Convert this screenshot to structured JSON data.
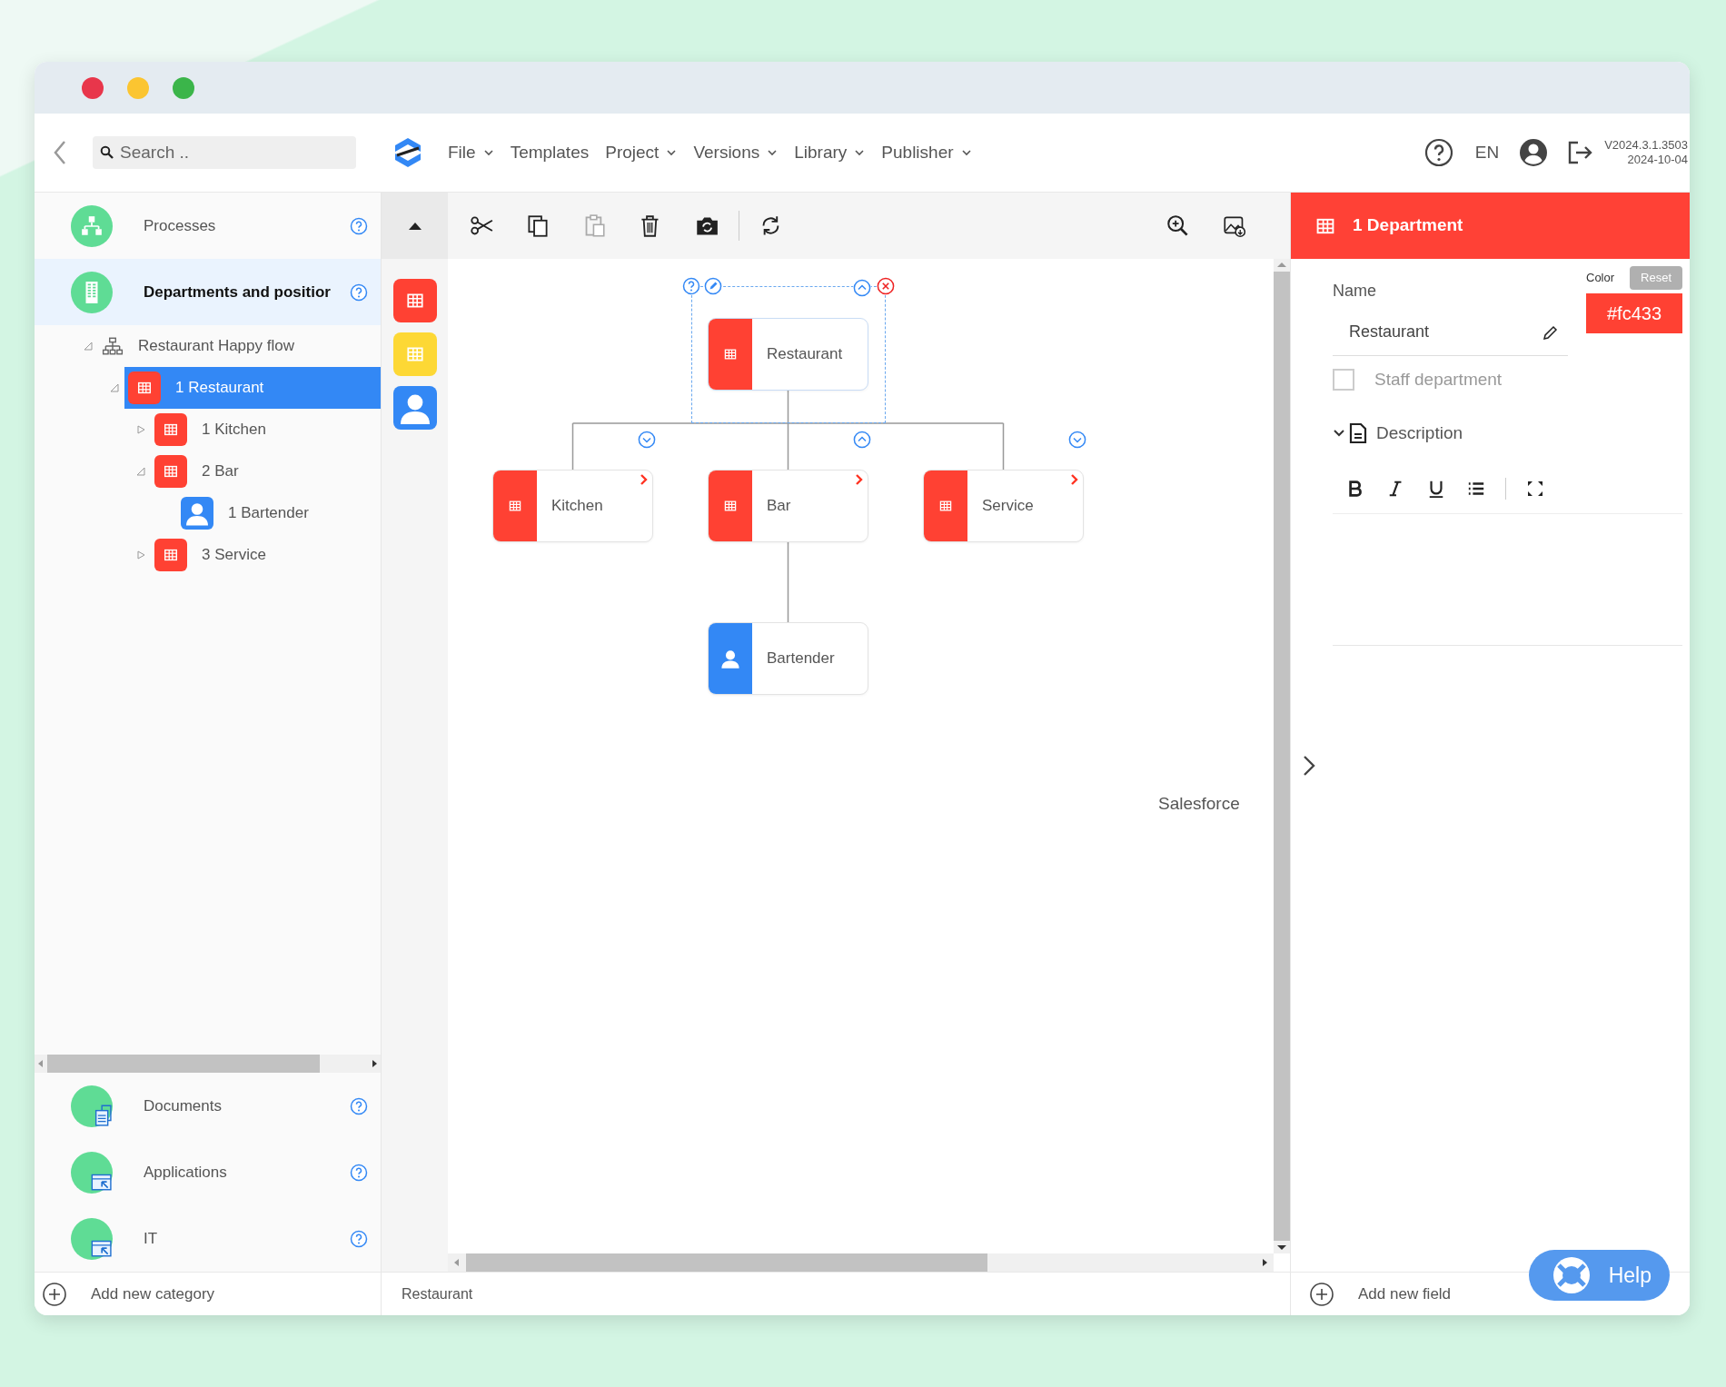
{
  "window": {
    "buttons": [
      {
        "color": "#e8364b"
      },
      {
        "color": "#fbc531"
      },
      {
        "color": "#3bb54a"
      }
    ]
  },
  "topbar": {
    "search": {
      "placeholder": "Search .."
    },
    "menu": [
      {
        "label": "File",
        "dropdown": true
      },
      {
        "label": "Templates",
        "dropdown": false
      },
      {
        "label": "Project",
        "dropdown": true
      },
      {
        "label": "Versions",
        "dropdown": true
      },
      {
        "label": "Library",
        "dropdown": true
      },
      {
        "label": "Publisher",
        "dropdown": true
      }
    ],
    "language": "EN",
    "version": "V2024.3.1.3503",
    "date": "2024-10-04"
  },
  "sidebar": {
    "categories": [
      {
        "label": "Processes",
        "kind": "processes",
        "selected": false
      },
      {
        "label": "Departments and positior",
        "kind": "departments",
        "selected": true
      }
    ],
    "tree": [
      {
        "label": "Restaurant Happy flow",
        "kind": "flow",
        "expanded": true,
        "selected": false,
        "children": [
          {
            "label": "1 Restaurant",
            "kind": "department",
            "expanded": true,
            "selected": true,
            "children": [
              {
                "label": "1 Kitchen",
                "kind": "department",
                "expanded": false,
                "selected": false
              },
              {
                "label": "2 Bar",
                "kind": "department",
                "expanded": true,
                "selected": false,
                "children": [
                  {
                    "label": "1 Bartender",
                    "kind": "position",
                    "selected": false
                  }
                ]
              },
              {
                "label": "3 Service",
                "kind": "department",
                "expanded": false,
                "selected": false
              }
            ]
          }
        ]
      }
    ],
    "more_categories": [
      {
        "label": "Documents",
        "kind": "documents"
      },
      {
        "label": "Applications",
        "kind": "applications"
      },
      {
        "label": "IT",
        "kind": "applications"
      }
    ],
    "add_label": "Add new category"
  },
  "palette": [
    {
      "kind": "department",
      "color": "#ff4133"
    },
    {
      "kind": "department",
      "color": "#fdd835"
    },
    {
      "kind": "position",
      "color": "#3388f5"
    }
  ],
  "toolbar": {
    "left": [
      {
        "kind": "cut",
        "disabled": false
      },
      {
        "kind": "copy",
        "disabled": false
      },
      {
        "kind": "paste",
        "disabled": true
      },
      {
        "kind": "delete",
        "disabled": false
      },
      {
        "kind": "camera",
        "disabled": false
      },
      {
        "kind": "refresh",
        "disabled": false
      }
    ],
    "right": [
      {
        "kind": "zoom",
        "disabled": false
      },
      {
        "kind": "export",
        "disabled": false
      }
    ]
  },
  "diagram": {
    "root": {
      "label": "Restaurant",
      "kind": "department",
      "selected": true,
      "expanded": true,
      "has_detail": false,
      "children": [
        {
          "label": "Kitchen",
          "kind": "department",
          "selected": false,
          "expanded": false,
          "has_detail": true
        },
        {
          "label": "Bar",
          "kind": "department",
          "selected": false,
          "expanded": true,
          "has_detail": true,
          "children": [
            {
              "label": "Bartender",
              "kind": "position",
              "selected": false,
              "has_detail": false
            }
          ]
        },
        {
          "label": "Service",
          "kind": "department",
          "selected": false,
          "expanded": false,
          "has_detail": true
        }
      ]
    },
    "label": "Salesforce"
  },
  "status": "Restaurant",
  "panel": {
    "title": "1 Department",
    "name_label": "Name",
    "name_value": "Restaurant",
    "color_label": "Color",
    "reset": "Reset",
    "color_value": "#fc433",
    "staff": {
      "label": "Staff department",
      "checked": false
    },
    "description": {
      "label": "Description",
      "expanded": true
    },
    "add_label": "Add new field"
  },
  "help": "Help"
}
